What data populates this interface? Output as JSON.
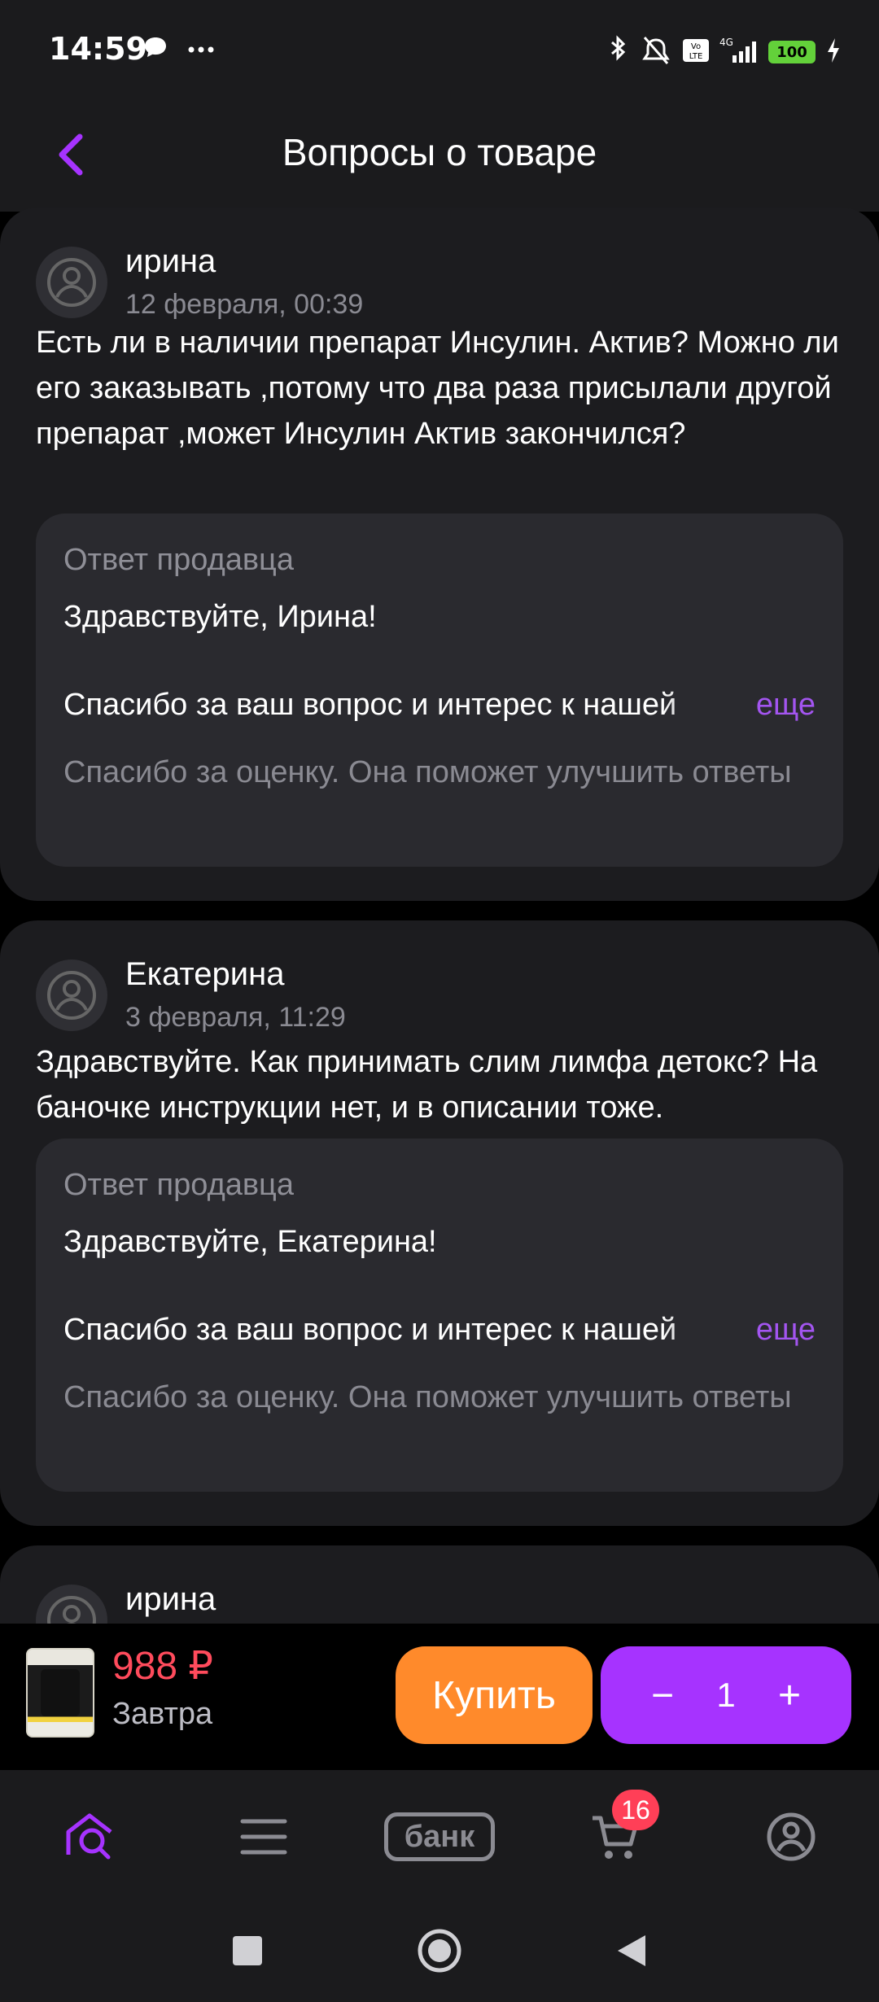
{
  "status": {
    "time": "14:59",
    "battery": "100"
  },
  "header": {
    "title": "Вопросы о товаре"
  },
  "questions": [
    {
      "author": "ирина",
      "date": "12 февраля, 00:39",
      "text": "Есть ли в наличии препарат Инсулин. Актив? Можно ли его заказывать ,потому что два раза присылали другой препарат ,может Инсулин Актив закончился?",
      "reply_label": "Ответ продавца",
      "reply_greeting": "Здравствуйте, Ирина!",
      "reply_body": "Спасибо за ваш вопрос и интерес к нашей",
      "more_label": "еще",
      "rating_note": "Спасибо за оценку. Она поможет улучшить ответы"
    },
    {
      "author": "Екатерина",
      "date": "3 февраля, 11:29",
      "text": "Здравствуйте. Как принимать слим лимфа детокс? На баночке инструкции нет, и в описании тоже.",
      "reply_label": "Ответ продавца",
      "reply_greeting": "Здравствуйте, Екатерина!",
      "reply_body": "Спасибо за ваш вопрос и интерес к нашей",
      "more_label": "еще",
      "rating_note": "Спасибо за оценку. Она поможет улучшить ответы"
    },
    {
      "author": "ирина"
    }
  ],
  "buybar": {
    "price": "988 ₽",
    "delivery": "Завтра",
    "buy_label": "Купить",
    "quantity": "1",
    "minus": "−",
    "plus": "+"
  },
  "nav": {
    "bank_label": "банк",
    "cart_count": "16"
  },
  "colors": {
    "accent": "#a633ff",
    "buy": "#ff8a2b",
    "price": "#ff4b5c",
    "card": "#1c1c1f",
    "reply": "#2a2a2f"
  }
}
